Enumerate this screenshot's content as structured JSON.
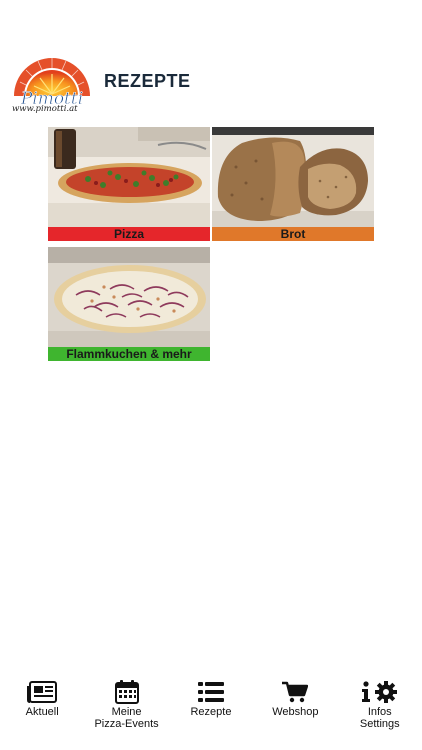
{
  "header": {
    "logo_text": "Pimotti",
    "logo_url": "www.pimotti.at",
    "logo_arc_text": "Der Pizzastein",
    "title": "REZEPTE"
  },
  "recipes": [
    {
      "label": "Pizza",
      "color": "#e5262b",
      "icon": "pizza-photo"
    },
    {
      "label": "Brot",
      "color": "#e0782a",
      "icon": "bread-photo"
    },
    {
      "label": "Flammkuchen & mehr",
      "color": "#3fb52f",
      "icon": "tarte-flambee-photo"
    }
  ],
  "tabbar": {
    "items": [
      {
        "label": "Aktuell",
        "icon": "newspaper-icon"
      },
      {
        "label": "Meine\nPizza-Events",
        "icon": "calendar-icon"
      },
      {
        "label": "Rezepte",
        "icon": "list-icon"
      },
      {
        "label": "Webshop",
        "icon": "cart-icon"
      },
      {
        "label": "Infos\nSettings",
        "icon": "info-gear-icon"
      }
    ]
  }
}
